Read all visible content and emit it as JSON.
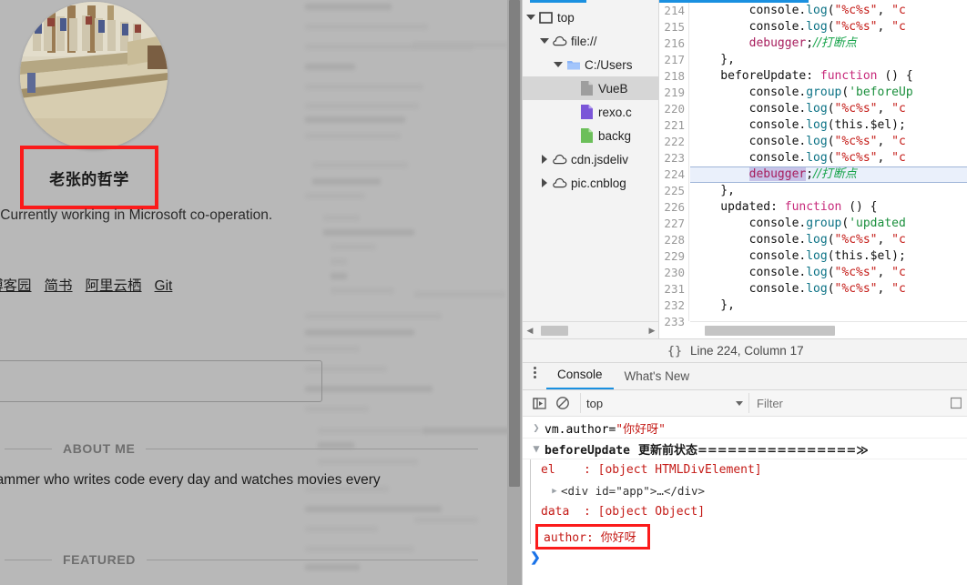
{
  "page": {
    "avatar_alt": "classical-painting-avatar",
    "site_title": "老张的哲学",
    "tagline": ".Currently working in Microsoft co-operation.",
    "links": [
      {
        "label": "博客园",
        "name": "link-cnblogs"
      },
      {
        "label": "简书",
        "name": "link-jianshu"
      },
      {
        "label": "阿里云栖",
        "name": "link-aliyun"
      },
      {
        "label": "Git",
        "name": "link-git"
      }
    ],
    "search_placeholder": "",
    "sections": [
      {
        "label": "ABOUT ME",
        "name": "section-about-me"
      },
      {
        "label": "FEATURED",
        "name": "section-featured"
      }
    ],
    "about_text": "rogrammer who writes code every day and watches movies every"
  },
  "devtools": {
    "tree": [
      {
        "label": "top",
        "indent": 0,
        "caret": "down",
        "icon": "frame-icon",
        "selected": false
      },
      {
        "label": "file://",
        "indent": 1,
        "caret": "down",
        "icon": "cloud-icon",
        "selected": false
      },
      {
        "label": "C:/Users",
        "indent": 2,
        "caret": "down",
        "icon": "folder-icon",
        "selected": false
      },
      {
        "label": "VueB",
        "indent": 3,
        "caret": "none",
        "icon": "file-gray-icon",
        "selected": true
      },
      {
        "label": "rexo.c",
        "indent": 3,
        "caret": "none",
        "icon": "file-purple-icon",
        "selected": false
      },
      {
        "label": "backg",
        "indent": 3,
        "caret": "none",
        "icon": "file-green-icon",
        "selected": false
      },
      {
        "label": "cdn.jsdeliv",
        "indent": 1,
        "caret": "right",
        "icon": "cloud-icon",
        "selected": false
      },
      {
        "label": "pic.cnblog",
        "indent": 1,
        "caret": "right",
        "icon": "cloud-icon",
        "selected": false
      }
    ],
    "editor": {
      "first_line": 214,
      "breakpoint_line": 224,
      "lines": [
        {
          "n": 214,
          "tokens": [
            {
              "t": "plain",
              "s": "        console."
            },
            {
              "t": "prop",
              "s": "log"
            },
            {
              "t": "plain",
              "s": "("
            },
            {
              "t": "str",
              "s": "\"%c%s\""
            },
            {
              "t": "plain",
              "s": ", "
            },
            {
              "t": "str",
              "s": "\"c"
            }
          ]
        },
        {
          "n": 215,
          "tokens": [
            {
              "t": "plain",
              "s": "        console."
            },
            {
              "t": "prop",
              "s": "log"
            },
            {
              "t": "plain",
              "s": "("
            },
            {
              "t": "str",
              "s": "\"%c%s\""
            },
            {
              "t": "plain",
              "s": ", "
            },
            {
              "t": "str",
              "s": "\"c"
            }
          ]
        },
        {
          "n": 216,
          "tokens": [
            {
              "t": "plain",
              "s": "        "
            },
            {
              "t": "key",
              "s": "debugger"
            },
            {
              "t": "plain",
              "s": ";"
            },
            {
              "t": "com",
              "s": "//打断点"
            }
          ]
        },
        {
          "n": 217,
          "tokens": [
            {
              "t": "plain",
              "s": "    },"
            }
          ]
        },
        {
          "n": 218,
          "tokens": [
            {
              "t": "plain",
              "s": "    beforeUpdate: "
            },
            {
              "t": "fn",
              "s": "function"
            },
            {
              "t": "plain",
              "s": " () {"
            }
          ]
        },
        {
          "n": 219,
          "tokens": [
            {
              "t": "plain",
              "s": "        console."
            },
            {
              "t": "prop",
              "s": "group"
            },
            {
              "t": "plain",
              "s": "("
            },
            {
              "t": "str2",
              "s": "'beforeUp"
            }
          ]
        },
        {
          "n": 220,
          "tokens": [
            {
              "t": "plain",
              "s": "        console."
            },
            {
              "t": "prop",
              "s": "log"
            },
            {
              "t": "plain",
              "s": "("
            },
            {
              "t": "str",
              "s": "\"%c%s\""
            },
            {
              "t": "plain",
              "s": ", "
            },
            {
              "t": "str",
              "s": "\"c"
            }
          ]
        },
        {
          "n": 221,
          "tokens": [
            {
              "t": "plain",
              "s": "        console."
            },
            {
              "t": "prop",
              "s": "log"
            },
            {
              "t": "plain",
              "s": "(this.$el);"
            }
          ]
        },
        {
          "n": 222,
          "tokens": [
            {
              "t": "plain",
              "s": "        console."
            },
            {
              "t": "prop",
              "s": "log"
            },
            {
              "t": "plain",
              "s": "("
            },
            {
              "t": "str",
              "s": "\"%c%s\""
            },
            {
              "t": "plain",
              "s": ", "
            },
            {
              "t": "str",
              "s": "\"c"
            }
          ]
        },
        {
          "n": 223,
          "tokens": [
            {
              "t": "plain",
              "s": "        console."
            },
            {
              "t": "prop",
              "s": "log"
            },
            {
              "t": "plain",
              "s": "("
            },
            {
              "t": "str",
              "s": "\"%c%s\""
            },
            {
              "t": "plain",
              "s": ", "
            },
            {
              "t": "str",
              "s": "\"c"
            }
          ]
        },
        {
          "n": 224,
          "tokens": [
            {
              "t": "plain",
              "s": "        "
            },
            {
              "t": "dbg",
              "s": "debugger"
            },
            {
              "t": "plain",
              "s": ";"
            },
            {
              "t": "com",
              "s": "//打断点"
            }
          ],
          "breakpoint": true
        },
        {
          "n": 225,
          "tokens": [
            {
              "t": "plain",
              "s": "    },"
            }
          ]
        },
        {
          "n": 226,
          "tokens": [
            {
              "t": "plain",
              "s": "    updated: "
            },
            {
              "t": "fn",
              "s": "function"
            },
            {
              "t": "plain",
              "s": " () {"
            }
          ]
        },
        {
          "n": 227,
          "tokens": [
            {
              "t": "plain",
              "s": "        console."
            },
            {
              "t": "prop",
              "s": "group"
            },
            {
              "t": "plain",
              "s": "("
            },
            {
              "t": "str2",
              "s": "'updated"
            }
          ]
        },
        {
          "n": 228,
          "tokens": [
            {
              "t": "plain",
              "s": "        console."
            },
            {
              "t": "prop",
              "s": "log"
            },
            {
              "t": "plain",
              "s": "("
            },
            {
              "t": "str",
              "s": "\"%c%s\""
            },
            {
              "t": "plain",
              "s": ", "
            },
            {
              "t": "str",
              "s": "\"c"
            }
          ]
        },
        {
          "n": 229,
          "tokens": [
            {
              "t": "plain",
              "s": "        console."
            },
            {
              "t": "prop",
              "s": "log"
            },
            {
              "t": "plain",
              "s": "(this.$el);"
            }
          ]
        },
        {
          "n": 230,
          "tokens": [
            {
              "t": "plain",
              "s": "        console."
            },
            {
              "t": "prop",
              "s": "log"
            },
            {
              "t": "plain",
              "s": "("
            },
            {
              "t": "str",
              "s": "\"%c%s\""
            },
            {
              "t": "plain",
              "s": ", "
            },
            {
              "t": "str",
              "s": "\"c"
            }
          ]
        },
        {
          "n": 231,
          "tokens": [
            {
              "t": "plain",
              "s": "        console."
            },
            {
              "t": "prop",
              "s": "log"
            },
            {
              "t": "plain",
              "s": "("
            },
            {
              "t": "str",
              "s": "\"%c%s\""
            },
            {
              "t": "plain",
              "s": ", "
            },
            {
              "t": "str",
              "s": "\"c"
            }
          ]
        },
        {
          "n": 232,
          "tokens": [
            {
              "t": "plain",
              "s": "    },"
            }
          ]
        },
        {
          "n": 233,
          "tokens": [
            {
              "t": "plain",
              "s": ""
            }
          ]
        }
      ]
    },
    "status": {
      "braces": "{}",
      "position": "Line 224, Column 17"
    },
    "drawer_tabs": [
      {
        "label": "Console",
        "active": true
      },
      {
        "label": "What's New",
        "active": false
      }
    ],
    "console_toolbar": {
      "context": "top",
      "filter_placeholder": "Filter",
      "sidebar_icon": "console-sidebar-icon",
      "clear_icon": "clear-console-icon"
    },
    "console_log": {
      "input_prefix": "vm.author=",
      "input_value": "\"你好呀\"",
      "group_label": "beforeUpdate",
      "group_suffix": "更新前状态================",
      "group_chevron": "≫",
      "rows": [
        {
          "key": "el",
          "sep": ": ",
          "value": "[object HTMLDivElement]"
        },
        {
          "dom": "<div id=\"app\">…</div>"
        },
        {
          "key": "data",
          "sep": ": ",
          "value": "[object Object]"
        },
        {
          "highlight": "author: 你好呀"
        }
      ],
      "prompt": "❯"
    }
  },
  "colors": {
    "accent": "#1a90e0",
    "highlight_red": "#fb1b1b",
    "console_red": "#c41a16",
    "breakpoint_bg": "#eaf0fb"
  }
}
